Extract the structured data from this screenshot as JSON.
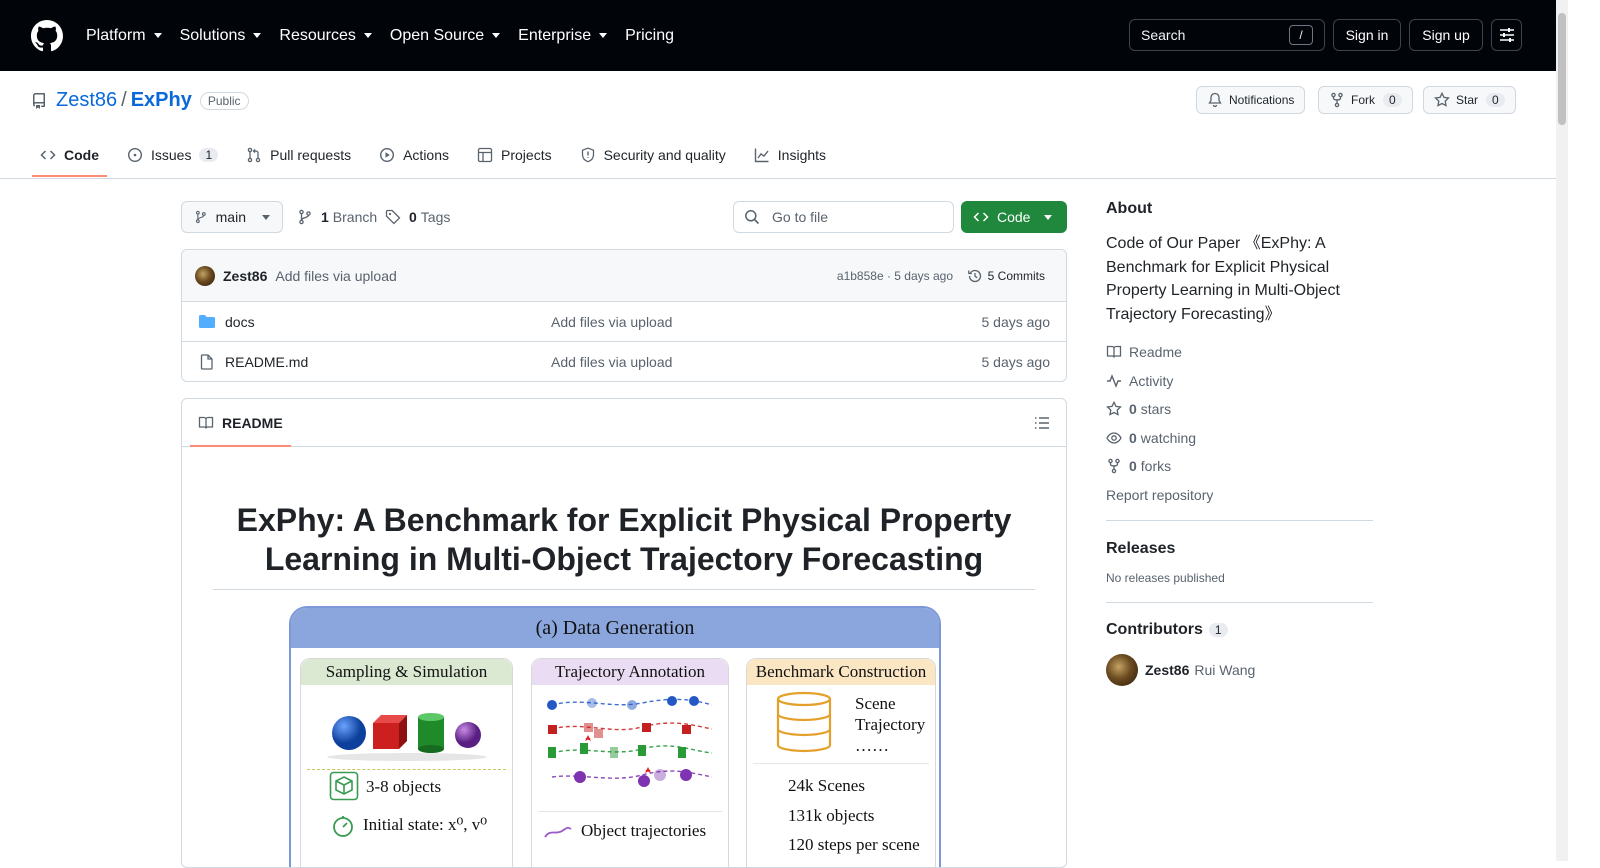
{
  "header": {
    "nav": [
      "Platform",
      "Solutions",
      "Resources",
      "Open Source",
      "Enterprise",
      "Pricing"
    ],
    "nav_has_caret": [
      true,
      true,
      true,
      true,
      true,
      false
    ],
    "search_label": "Search",
    "search_key": "/",
    "signin": "Sign in",
    "signup": "Sign up"
  },
  "repo": {
    "owner": "Zest86",
    "separator": "/",
    "name": "ExPhy",
    "visibility": "Public",
    "notifications": "Notifications",
    "fork_label": "Fork",
    "fork_count": "0",
    "star_label": "Star",
    "star_count": "0",
    "tabs": [
      {
        "label": "Code",
        "icon": "code-icon",
        "count": ""
      },
      {
        "label": "Issues",
        "icon": "issue-icon",
        "count": "1"
      },
      {
        "label": "Pull requests",
        "icon": "pull-request-icon",
        "count": ""
      },
      {
        "label": "Actions",
        "icon": "play-icon",
        "count": ""
      },
      {
        "label": "Projects",
        "icon": "table-icon",
        "count": ""
      },
      {
        "label": "Security and quality",
        "icon": "shield-icon",
        "count": ""
      },
      {
        "label": "Insights",
        "icon": "graph-icon",
        "count": ""
      }
    ]
  },
  "toolbar": {
    "branch": "main",
    "branch_count": "1",
    "branch_label": "Branch",
    "tag_count": "0",
    "tag_label": "Tags",
    "goto_placeholder": "Go to file",
    "code_button": "Code"
  },
  "commit": {
    "author": "Zest86",
    "message": "Add files via upload",
    "hash_time": "a1b858e · 5 days ago",
    "commits": "5 Commits"
  },
  "files": [
    {
      "name": "docs",
      "type": "folder",
      "commit": "Add files via upload",
      "date": "5 days ago"
    },
    {
      "name": "README.md",
      "type": "file",
      "commit": "Add files via upload",
      "date": "5 days ago"
    }
  ],
  "readme": {
    "tab": "README",
    "title_line1": "ExPhy: A Benchmark for Explicit Physical Property",
    "title_line2": "Learning in Multi-Object Trajectory Forecasting",
    "figure": {
      "header": "(a) Data Generation",
      "panel1_title": "Sampling & Simulation",
      "panel1_line1": "3-8 objects",
      "panel1_line2": "Initial state: x⁰, v⁰",
      "panel2_title": "Trajectory Annotation",
      "panel2_line1": "Object trajectories",
      "panel3_title": "Benchmark Construction",
      "panel3_list": [
        "Scene",
        "Trajectory",
        "……"
      ],
      "panel3_stats": [
        "24k Scenes",
        "131k objects",
        "120 steps per scene"
      ]
    }
  },
  "about": {
    "title": "About",
    "description": "Code of Our Paper 《ExPhy: A Benchmark for Explicit Physical Property Learning in Multi-Object Trajectory Forecasting》",
    "readme": "Readme",
    "activity": "Activity",
    "stars_count": "0",
    "stars_label": "stars",
    "watching_count": "0",
    "watching_label": "watching",
    "forks_count": "0",
    "forks_label": "forks",
    "report": "Report repository"
  },
  "releases": {
    "title": "Releases",
    "empty": "No releases published"
  },
  "contributors": {
    "title": "Contributors",
    "count": "1",
    "login": "Zest86",
    "name": "Rui Wang"
  },
  "colors": {
    "topbar": "#010409",
    "link": "#0969da",
    "code_button": "#1f883d",
    "tab_underline": "#fd8c73"
  }
}
